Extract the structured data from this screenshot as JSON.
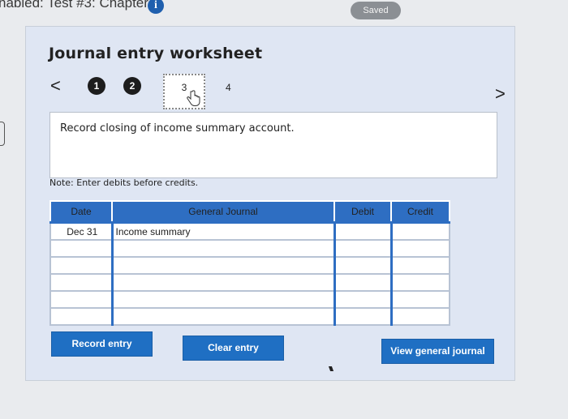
{
  "top": {
    "title": "nabled: Test #3: Chapter 4",
    "info_glyph": "i",
    "saved_label": "Saved"
  },
  "worksheet": {
    "title": "Journal entry worksheet",
    "nav_prev": "<",
    "nav_next": ">",
    "steps": [
      "1",
      "2",
      "3",
      "4"
    ],
    "current_step": 3,
    "description": "Record closing of income summary account.",
    "note": "Note: Enter debits before credits."
  },
  "journal": {
    "headers": {
      "date": "Date",
      "general_journal": "General Journal",
      "debit": "Debit",
      "credit": "Credit"
    },
    "rows": [
      {
        "date": "Dec 31",
        "account": "Income summary",
        "debit": "",
        "credit": ""
      },
      {
        "date": "",
        "account": "",
        "debit": "",
        "credit": ""
      },
      {
        "date": "",
        "account": "",
        "debit": "",
        "credit": ""
      },
      {
        "date": "",
        "account": "",
        "debit": "",
        "credit": ""
      },
      {
        "date": "",
        "account": "",
        "debit": "",
        "credit": ""
      },
      {
        "date": "",
        "account": "",
        "debit": "",
        "credit": ""
      }
    ]
  },
  "buttons": {
    "record": "Record entry",
    "clear": "Clear entry",
    "view": "View general journal"
  },
  "icons": {
    "info": "info-icon",
    "hand": "hand-pointer-icon"
  },
  "colors": {
    "accent": "#1f6fc3",
    "table_header": "#2e6ec2",
    "panel": "#dfe6f3"
  }
}
